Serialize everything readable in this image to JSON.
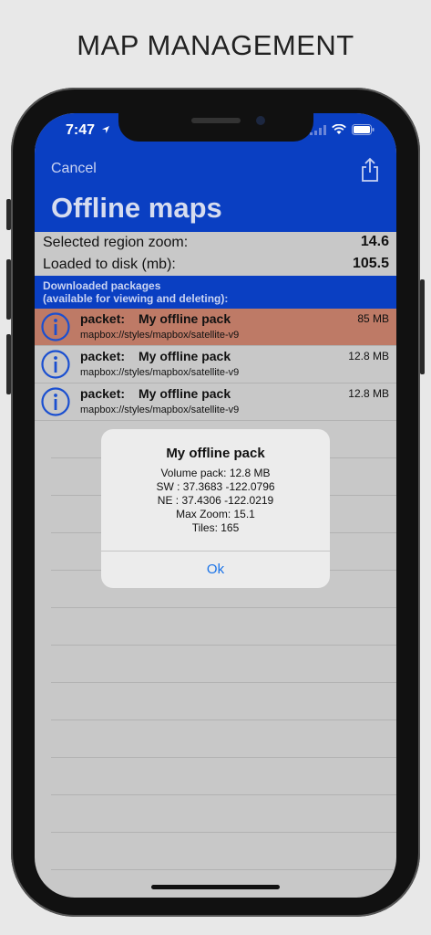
{
  "banner": {
    "title": "MAP MANAGEMENT"
  },
  "status_bar": {
    "time": "7:47"
  },
  "nav": {
    "cancel_label": "Cancel",
    "title": "Offline maps"
  },
  "stats": [
    {
      "label": "Selected region zoom:",
      "value": "14.6"
    },
    {
      "label": "Loaded to disk (mb):",
      "value": "105.5"
    }
  ],
  "section": {
    "line1": "Downloaded packages",
    "line2": "(available for viewing and deleting):"
  },
  "packs": [
    {
      "kind": "packet:",
      "name": "My offline pack",
      "size": "85 MB",
      "style": "mapbox://styles/mapbox/satellite-v9"
    },
    {
      "kind": "packet:",
      "name": "My offline pack",
      "size": "12.8 MB",
      "style": "mapbox://styles/mapbox/satellite-v9"
    },
    {
      "kind": "packet:",
      "name": "My offline pack",
      "size": "12.8 MB",
      "style": "mapbox://styles/mapbox/satellite-v9"
    }
  ],
  "alert": {
    "title": "My offline pack",
    "lines": [
      "Volume pack: 12.8 MB",
      "SW : 37.3683 -122.0796",
      "NE : 37.4306 -122.0219",
      "Max Zoom: 15.1",
      "Tiles: 165"
    ],
    "ok_label": "Ok"
  },
  "colors": {
    "header_blue": "#0a3fc2",
    "selected_row": "#be7a66",
    "list_bg": "#c8c8c8",
    "ok_blue": "#1a73e8"
  },
  "icons": [
    "location-arrow-icon",
    "signal-icon",
    "wifi-icon",
    "battery-icon",
    "share-icon",
    "info-icon"
  ]
}
